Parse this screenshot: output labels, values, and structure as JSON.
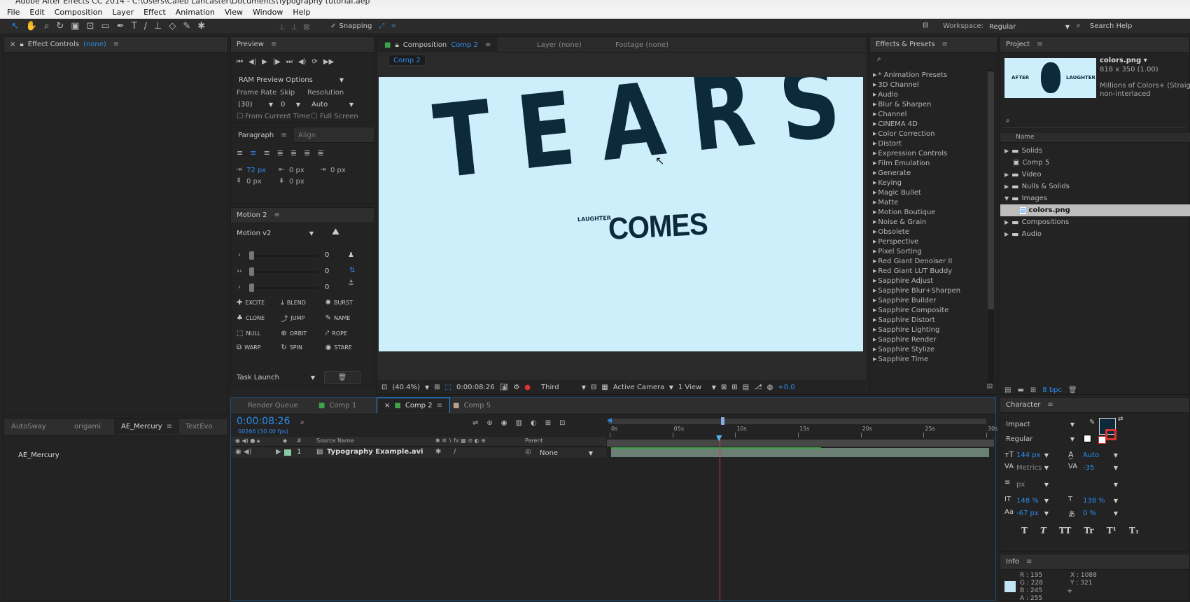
{
  "titlebar": {
    "title": "Adobe After Effects CC 2014 - C:\\Users\\Caleb Lancaster\\Documents\\Typography tutorial.aep"
  },
  "menubar": [
    "File",
    "Edit",
    "Composition",
    "Layer",
    "Effect",
    "Animation",
    "View",
    "Window",
    "Help"
  ],
  "toolbar": {
    "snapping": "Snapping",
    "workspace_label": "Workspace:",
    "workspace_value": "Regular",
    "search_help": "Search Help"
  },
  "effect_controls": {
    "title": "Effect Controls",
    "value": "(none)"
  },
  "preview": {
    "title": "Preview",
    "ram_options": "RAM Preview Options",
    "frame_rate_label": "Frame Rate",
    "skip_label": "Skip",
    "resolution_label": "Resolution",
    "frame_rate": "(30)",
    "skip": "0",
    "resolution": "Auto",
    "from_current": "From Current Time",
    "full_screen": "Full Screen"
  },
  "paragraph": {
    "title": "Paragraph",
    "align_tab": "Align",
    "indent_left": "72 px",
    "indent_right": "0 px",
    "indent_first": "0 px",
    "space_before": "0 px",
    "space_after": "0 px"
  },
  "motion": {
    "title": "Motion 2",
    "version": "Motion v2",
    "sliders": [
      "0",
      "0",
      "0"
    ],
    "buttons": [
      "EXCITE",
      "BLEND",
      "BURST",
      "CLONE",
      "JUMP",
      "NAME",
      "NULL",
      "ORBIT",
      "ROPE",
      "WARP",
      "SPIN",
      "STARE"
    ],
    "task": "Task Launch"
  },
  "composition": {
    "title": "Composition",
    "comp_name": "Comp 2",
    "layer_tab": "Layer (none)",
    "footage_tab": "Footage (none)",
    "breadcrumb": "Comp 2",
    "zoom": "(40.4%)",
    "timecode": "0:00:08:26",
    "resolution": "Third",
    "camera": "Active Camera",
    "views": "1 View",
    "exposure": "+0.0"
  },
  "canvas": {
    "bg": "#cdeffb",
    "word": "TEARS",
    "small_text": "LAUGHTER",
    "sub_word": "COMES"
  },
  "effects": {
    "title": "Effects & Presets",
    "items": [
      "* Animation Presets",
      "3D Channel",
      "Audio",
      "Blur & Sharpen",
      "Channel",
      "CINEMA 4D",
      "Color Correction",
      "Distort",
      "Expression Controls",
      "Film Emulation",
      "Generate",
      "Keying",
      "Magic Bullet",
      "Matte",
      "Motion Boutique",
      "Noise & Grain",
      "Obsolete",
      "Perspective",
      "Pixel Sorting",
      "Red Giant Denoiser II",
      "Red Giant LUT Buddy",
      "Sapphire Adjust",
      "Sapphire Blur+Sharpen",
      "Sapphire Builder",
      "Sapphire Composite",
      "Sapphire Distort",
      "Sapphire Lighting",
      "Sapphire Render",
      "Sapphire Stylize",
      "Sapphire Time"
    ]
  },
  "project": {
    "title": "Project",
    "file_name": "colors.png ▾",
    "file_dims": "818 x 350 (1.00)",
    "file_colors": "Millions of Colors+ (Straight)",
    "file_interlace": "non-interlaced",
    "thumb_left": "AFTER",
    "thumb_right": "LAUGHTER",
    "column_name": "Name",
    "items": [
      {
        "label": "Solids",
        "type": "folder",
        "indent": 0,
        "open": false
      },
      {
        "label": "Comp 5",
        "type": "comp",
        "indent": 0,
        "open": false
      },
      {
        "label": "Video",
        "type": "folder",
        "indent": 0,
        "open": false
      },
      {
        "label": "Nulls & Solids",
        "type": "folder",
        "indent": 0,
        "open": false
      },
      {
        "label": "Images",
        "type": "folder",
        "indent": 0,
        "open": true
      },
      {
        "label": "colors.png",
        "type": "file",
        "indent": 1,
        "selected": true
      },
      {
        "label": "Compositions",
        "type": "folder",
        "indent": 0,
        "open": false
      },
      {
        "label": "Audio",
        "type": "folder",
        "indent": 0,
        "open": false
      }
    ],
    "bpc": "8 bpc"
  },
  "bottom_left": {
    "tabs": [
      "AutoSway",
      "origami",
      "AE_Mercury",
      "TextEvo"
    ],
    "active": "AE_Mercury",
    "content": "AE_Mercury"
  },
  "timeline": {
    "tabs": [
      "Render Queue",
      "Comp 1",
      "Comp 2",
      "Comp 5"
    ],
    "timecode": "0:00:08:26",
    "frames": "00266 (30.00 fps)",
    "col_source": "Source Name",
    "col_parent": "Parent",
    "layer_num": "1",
    "layer_name": "Typography Example.avi",
    "parent_value": "None",
    "ruler": [
      "0s",
      "05s",
      "10s",
      "15s",
      "20s",
      "25s",
      "30s"
    ]
  },
  "character": {
    "title": "Character",
    "font": "Impact",
    "style": "Regular",
    "size": "144 px",
    "leading": "Auto",
    "kerning": "Metrics",
    "tracking": "-35",
    "stroke_unit": "px",
    "vscale": "148 %",
    "hscale": "138 %",
    "baseline": "-67 px",
    "tsume": "0 %",
    "styles": [
      "T",
      "T",
      "TT",
      "Tr",
      "T¹",
      "T₁"
    ]
  },
  "info": {
    "title": "Info",
    "r": "R : 195",
    "g": "G : 228",
    "b": "B : 245",
    "a": "A : 255",
    "x": "X : 1088",
    "y": "Y : 321"
  }
}
